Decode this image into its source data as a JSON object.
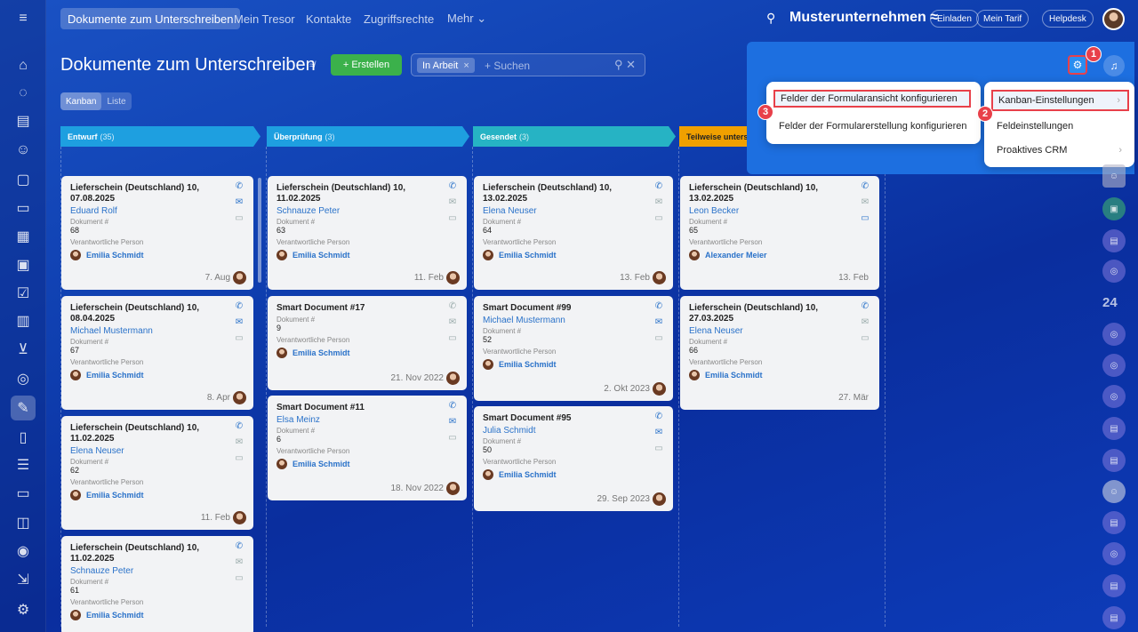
{
  "topnav": {
    "items": [
      "Dokumente zum Unterschreiben",
      "Mein Tresor",
      "Kontakte",
      "Zugriffsrechte",
      "Mehr ⌄"
    ],
    "company": "Musterunternehmen ≈",
    "pills": [
      "Einladen",
      "Mein Tarif",
      "Helpdesk"
    ]
  },
  "page": {
    "title": "Dokumente zum Unterschreiben",
    "create_label": "+ Erstellen",
    "filter_tag": "In Arbeit",
    "search_placeholder": "+ Suchen",
    "views": [
      "Kanban",
      "Liste"
    ]
  },
  "columns": [
    {
      "name": "Entwurf",
      "count": "(35)",
      "color": "#1e9fe0"
    },
    {
      "name": "Überprüfung",
      "count": "(3)",
      "color": "#1e9fe0"
    },
    {
      "name": "Gesendet",
      "count": "(3)",
      "color": "#26b3c4"
    },
    {
      "name": "Teilweise unterschri",
      "count": "",
      "color": "#f0a000"
    }
  ],
  "cards": [
    {
      "title": "Lieferschein (Deutschland) 10, 07.08.2025",
      "client": "Eduard Rolf",
      "doc_label": "Dokument #",
      "doc": "68",
      "resp_label": "Verantwortliche Person",
      "resp": "Emilia Schmidt",
      "date": "7. Aug"
    },
    {
      "title": "Lieferschein (Deutschland) 10, 08.04.2025",
      "client": "Michael Mustermann",
      "doc_label": "Dokument #",
      "doc": "67",
      "resp_label": "Verantwortliche Person",
      "resp": "Emilia Schmidt",
      "date": "8. Apr"
    },
    {
      "title": "Lieferschein (Deutschland) 10, 11.02.2025",
      "client": "Elena Neuser",
      "doc_label": "Dokument #",
      "doc": "62",
      "resp_label": "Verantwortliche Person",
      "resp": "Emilia Schmidt",
      "date": "11. Feb"
    },
    {
      "title": "Lieferschein (Deutschland) 10, 11.02.2025",
      "client": "Schnauze Peter",
      "doc_label": "Dokument #",
      "doc": "61",
      "resp_label": "Verantwortliche Person",
      "resp": "Emilia Schmidt",
      "date": ""
    },
    {
      "title": "Lieferschein (Deutschland) 10, 11.02.2025",
      "client": "Schnauze Peter",
      "doc_label": "Dokument #",
      "doc": "63",
      "resp_label": "Verantwortliche Person",
      "resp": "Emilia Schmidt",
      "date": "11. Feb"
    },
    {
      "title": "Smart Document #17",
      "client": "",
      "doc_label": "Dokument #",
      "doc": "9",
      "resp_label": "Verantwortliche Person",
      "resp": "Emilia Schmidt",
      "date": "21. Nov 2022"
    },
    {
      "title": "Smart Document #11",
      "client": "Elsa Meinz",
      "doc_label": "Dokument #",
      "doc": "6",
      "resp_label": "Verantwortliche Person",
      "resp": "Emilia Schmidt",
      "date": "18. Nov 2022"
    },
    {
      "title": "Lieferschein (Deutschland) 10, 13.02.2025",
      "client": "Elena Neuser",
      "doc_label": "Dokument #",
      "doc": "64",
      "resp_label": "Verantwortliche Person",
      "resp": "Emilia Schmidt",
      "date": "13. Feb"
    },
    {
      "title": "Smart Document #99",
      "client": "Michael Mustermann",
      "doc_label": "Dokument #",
      "doc": "52",
      "resp_label": "Verantwortliche Person",
      "resp": "Emilia Schmidt",
      "date": "2. Okt 2023"
    },
    {
      "title": "Smart Document #95",
      "client": "Julia Schmidt",
      "doc_label": "Dokument #",
      "doc": "50",
      "resp_label": "Verantwortliche Person",
      "resp": "Emilia Schmidt",
      "date": "29. Sep 2023"
    },
    {
      "title": "Lieferschein (Deutschland) 10, 13.02.2025",
      "client": "Leon Becker",
      "doc_label": "Dokument #",
      "doc": "65",
      "resp_label": "Verantwortliche Person",
      "resp": "Alexander Meier",
      "date": "13. Feb"
    },
    {
      "title": "Lieferschein (Deutschland) 10, 27.03.2025",
      "client": "Elena Neuser",
      "doc_label": "Dokument #",
      "doc": "66",
      "resp_label": "Verantwortliche Person",
      "resp": "Emilia Schmidt",
      "date": "27. Mär"
    }
  ],
  "menu_left": [
    "Felder der Formularansicht konfigurieren",
    "Felder der Formularerstellung konfigurieren"
  ],
  "menu_right": [
    "Kanban-Einstellungen",
    "Feldeinstellungen",
    "Proaktives CRM"
  ],
  "badges": [
    "1",
    "2",
    "3"
  ],
  "right_rail_number": "24",
  "icons": {
    "gear": "⚙",
    "bell": "🔔",
    "arrow": "›"
  }
}
